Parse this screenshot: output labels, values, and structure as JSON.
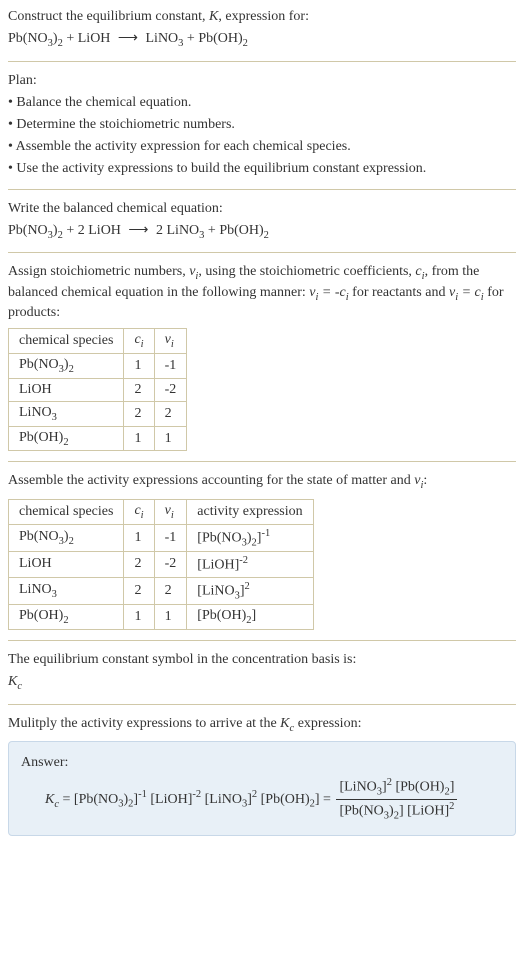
{
  "prompt": {
    "line1_a": "Construct the equilibrium constant, ",
    "line1_b": ", expression for:"
  },
  "eq_unbalanced": {
    "r1": {
      "name": "Pb(NO",
      "sub1": "3",
      "close": ")",
      "sub2": "2"
    },
    "r2": {
      "name": "LiOH"
    },
    "p1": {
      "name": "LiNO",
      "sub1": "3"
    },
    "p2": {
      "name": "Pb(OH)",
      "sub1": "2"
    }
  },
  "plan": {
    "heading": "Plan:",
    "b1": "• Balance the chemical equation.",
    "b2": "• Determine the stoichiometric numbers.",
    "b3": "• Assemble the activity expression for each chemical species.",
    "b4": "• Use the activity expressions to build the equilibrium constant expression."
  },
  "balance": {
    "heading": "Write the balanced chemical equation:",
    "c_r2": "2",
    "c_p1": "2"
  },
  "stoich": {
    "intro_a": "Assign stoichiometric numbers, ",
    "intro_b": ", using the stoichiometric coefficients, ",
    "intro_c": ", from the balanced chemical equation in the following manner: ",
    "intro_d": " for reactants and ",
    "intro_e": " for products:",
    "hdr_species": "chemical species",
    "rows": [
      {
        "ci": "1",
        "vi": "-1"
      },
      {
        "ci": "2",
        "vi": "-2"
      },
      {
        "ci": "2",
        "vi": "2"
      },
      {
        "ci": "1",
        "vi": "1"
      }
    ]
  },
  "activity": {
    "heading_a": "Assemble the activity expressions accounting for the state of matter and ",
    "heading_b": ":",
    "hdr_species": "chemical species",
    "hdr_act": "activity expression",
    "rows": [
      {
        "ci": "1",
        "vi": "-1",
        "exp": "-1"
      },
      {
        "ci": "2",
        "vi": "-2",
        "exp": "-2"
      },
      {
        "ci": "2",
        "vi": "2",
        "exp": "2"
      },
      {
        "ci": "1",
        "vi": "1",
        "exp": ""
      }
    ]
  },
  "symbolline": "The equilibrium constant symbol in the concentration basis is:",
  "multiply": {
    "line_a": "Mulitply the activity expressions to arrive at the ",
    "line_b": " expression:"
  },
  "answer": {
    "label": "Answer:",
    "exp1": "-1",
    "exp2": "-2",
    "exp3": "2",
    "num_exp1": "2",
    "den_exp1": "2"
  }
}
